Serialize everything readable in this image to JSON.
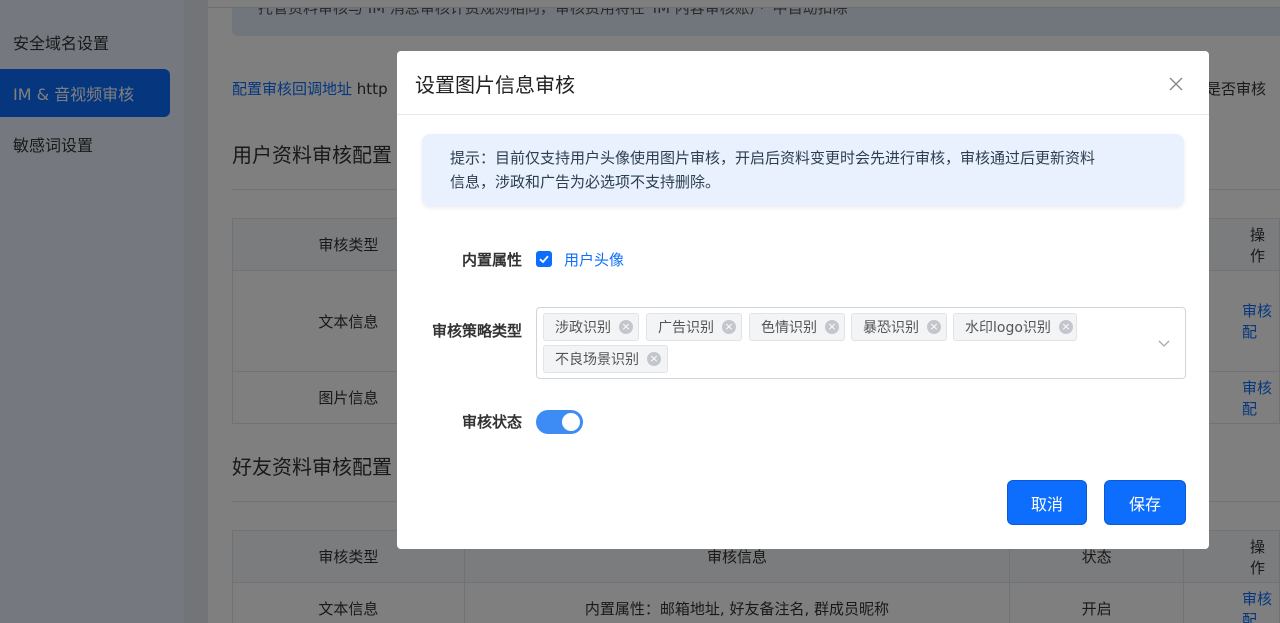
{
  "sidebar": {
    "items": [
      {
        "label": "安全域名设置",
        "active": false
      },
      {
        "label": "IM & 音视频审核",
        "active": true
      },
      {
        "label": "敏感词设置",
        "active": false
      }
    ]
  },
  "main": {
    "notice_text": "托管资料审核与 IM 消息审核计费规则相同，审核费用将在“IM 内容审核账户”中自动扣除",
    "callback_link": "配置审核回调地址",
    "callback_value": "http",
    "callback_right": "是否审核",
    "section1_title": "用户资料审核配置",
    "section2_title": "好友资料审核配置",
    "table1": {
      "head": {
        "type": "审核类型",
        "op": "操作"
      },
      "rows": [
        {
          "type": "文本信息",
          "op": "审核配"
        },
        {
          "type": "图片信息",
          "op": "审核配"
        }
      ]
    },
    "table2": {
      "head": {
        "type": "审核类型",
        "info": "审核信息",
        "status": "状态",
        "op": "操作"
      },
      "rows": [
        {
          "type": "文本信息",
          "info": "内置属性：邮箱地址, 好友备注名, 群成员昵称",
          "status": "开启",
          "op": "审核配"
        }
      ]
    }
  },
  "modal": {
    "title": "设置图片信息审核",
    "tip_line1": "提示：目前仅支持用户头像使用图片审核，开启后资料变更时会先进行审核，审核通过后更新资料",
    "tip_line2": "信息，涉政和广告为必选项不支持删除。",
    "builtin_label": "内置属性",
    "builtin_option": "用户头像",
    "builtin_checked": true,
    "strategy_label": "审核策略类型",
    "strategy_tags": [
      "涉政识别",
      "广告识别",
      "色情识别",
      "暴恐识别",
      "水印logo识别",
      "不良场景识别"
    ],
    "status_label": "审核状态",
    "status_on": true,
    "cancel_label": "取消",
    "save_label": "保存"
  },
  "colors": {
    "accent": "#0d6efd",
    "overlay": "rgba(0,0,0,0.5)"
  }
}
